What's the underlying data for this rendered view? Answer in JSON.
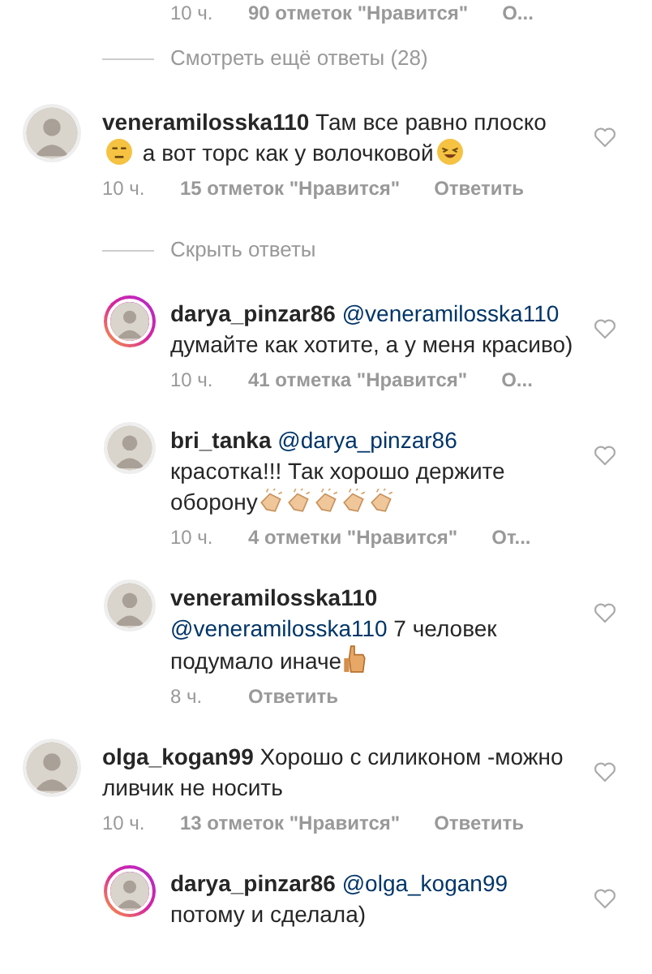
{
  "top_meta": {
    "time": "10 ч.",
    "likes": "90 отметок \"Нравится\"",
    "reply_label": "О..."
  },
  "items": [
    {
      "kind": "toggle",
      "text": "Смотреть ещё ответы (28)"
    },
    {
      "kind": "comment",
      "reply": false,
      "story_ring": false,
      "username": "veneramilosska110",
      "body": [
        {
          "kind": "text",
          "text": "Там все равно плоско"
        },
        {
          "kind": "smiley"
        },
        {
          "kind": "text",
          "text": "а вот торс как у волочковой"
        },
        {
          "kind": "laugh"
        }
      ],
      "time": "10 ч.",
      "likes": "15 отметок \"Нравится\"",
      "reply_label": "Ответить"
    },
    {
      "kind": "toggle",
      "text": "Скрыть ответы"
    },
    {
      "kind": "comment",
      "reply": true,
      "story_ring": true,
      "username": "darya_pinzar86",
      "body": [
        {
          "kind": "mention",
          "text": "@veneramilosska110"
        },
        {
          "kind": "text",
          "text": "думайте как хотите, а у меня красиво)"
        }
      ],
      "time": "10 ч.",
      "likes": "41 отметка \"Нравится\"",
      "reply_label": "О..."
    },
    {
      "kind": "comment",
      "reply": true,
      "story_ring": false,
      "username": "bri_tanka",
      "body": [
        {
          "kind": "mention",
          "text": "@darya_pinzar86"
        },
        {
          "kind": "text",
          "text": "красотка!!! Так хорошо держите оборону"
        },
        {
          "kind": "clap"
        },
        {
          "kind": "clap"
        },
        {
          "kind": "clap"
        },
        {
          "kind": "clap"
        },
        {
          "kind": "clap"
        }
      ],
      "time": "10 ч.",
      "likes": "4 отметки \"Нравится\"",
      "reply_label": "От..."
    },
    {
      "kind": "comment",
      "reply": true,
      "story_ring": false,
      "username": "veneramilosska110",
      "body": [
        {
          "kind": "break"
        },
        {
          "kind": "mention",
          "text": "@veneramilosska110"
        },
        {
          "kind": "text",
          "text": "7 человек подумало иначе"
        },
        {
          "kind": "thumb"
        }
      ],
      "time": "8 ч.",
      "reply_label": "Ответить"
    },
    {
      "kind": "comment",
      "reply": false,
      "story_ring": false,
      "username": "olga_kogan99",
      "body": [
        {
          "kind": "text",
          "text": "Хорошо с силиконом -можно ливчик не носить"
        }
      ],
      "time": "10 ч.",
      "likes": "13 отметок \"Нравится\"",
      "reply_label": "Ответить"
    },
    {
      "kind": "comment",
      "reply": true,
      "story_ring": true,
      "username": "darya_pinzar86",
      "body": [
        {
          "kind": "mention",
          "text": "@olga_kogan99"
        },
        {
          "kind": "text",
          "text": "потому и сделала)"
        }
      ]
    }
  ]
}
